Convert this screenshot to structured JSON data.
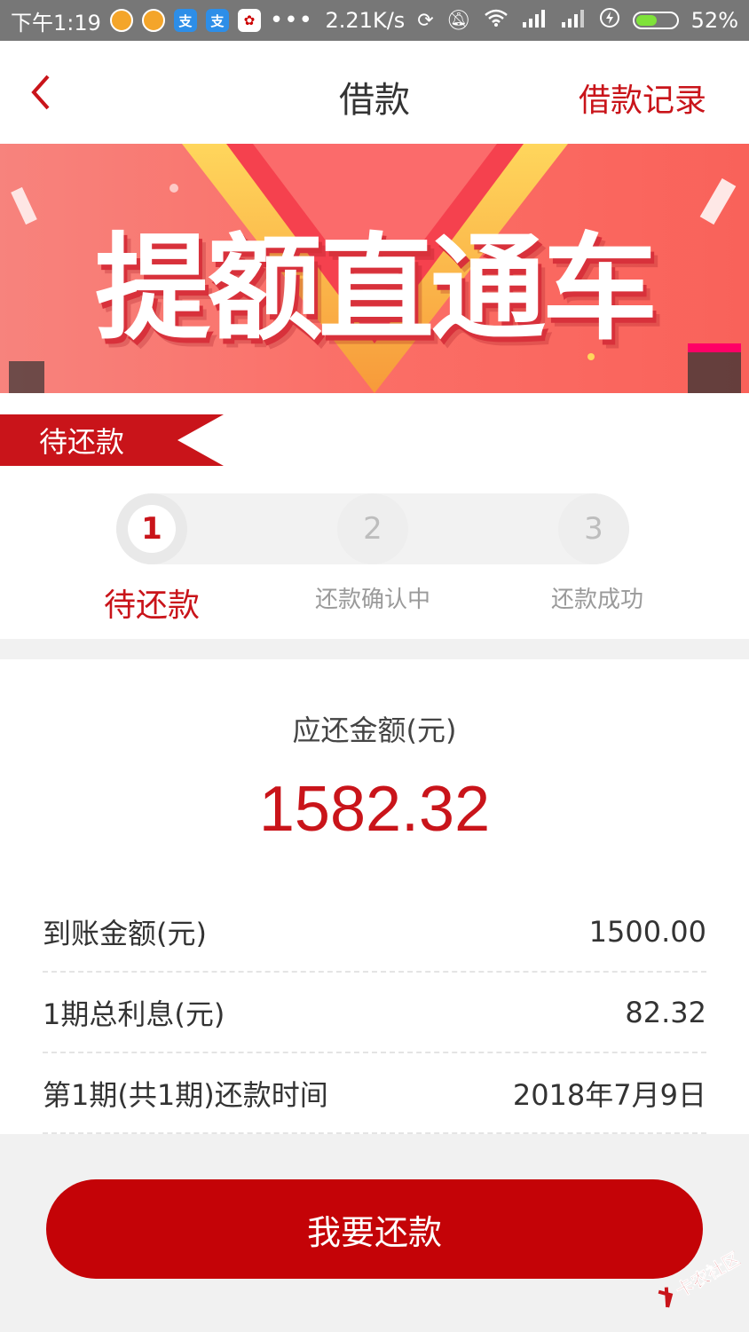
{
  "status_bar": {
    "time": "下午1:19",
    "net_speed": "2.21K/s",
    "battery": "52%",
    "battery_level": 0.52,
    "app_icons": [
      "chat-bubble-icon",
      "chat-bubble-icon",
      "alipay-icon",
      "alipay-icon",
      "app-icon"
    ],
    "alipay_glyph": "支",
    "more": "•••"
  },
  "nav": {
    "title": "借款",
    "action": "借款记录"
  },
  "banner": {
    "title": "提额直通车",
    "slide_count": 5,
    "active_slide": 1
  },
  "status_tag": "待还款",
  "steps": [
    {
      "number": "1",
      "label": "待还款",
      "active": true
    },
    {
      "number": "2",
      "label": "还款确认中",
      "active": false
    },
    {
      "number": "3",
      "label": "还款成功",
      "active": false
    }
  ],
  "repayment": {
    "amount_label": "应还金额(元)",
    "amount": "1582.32",
    "rows": [
      {
        "label": "到账金额(元)",
        "value": "1500.00"
      },
      {
        "label": "1期总利息(元)",
        "value": "82.32"
      },
      {
        "label": "第1期(共1期)还款时间",
        "value": "2018年7月9日"
      }
    ]
  },
  "button": {
    "label": "我要还款"
  },
  "watermark": "卡农社区",
  "colors": {
    "accent": "#c9141a",
    "button": "#c40307",
    "status_bar": "#777777"
  }
}
